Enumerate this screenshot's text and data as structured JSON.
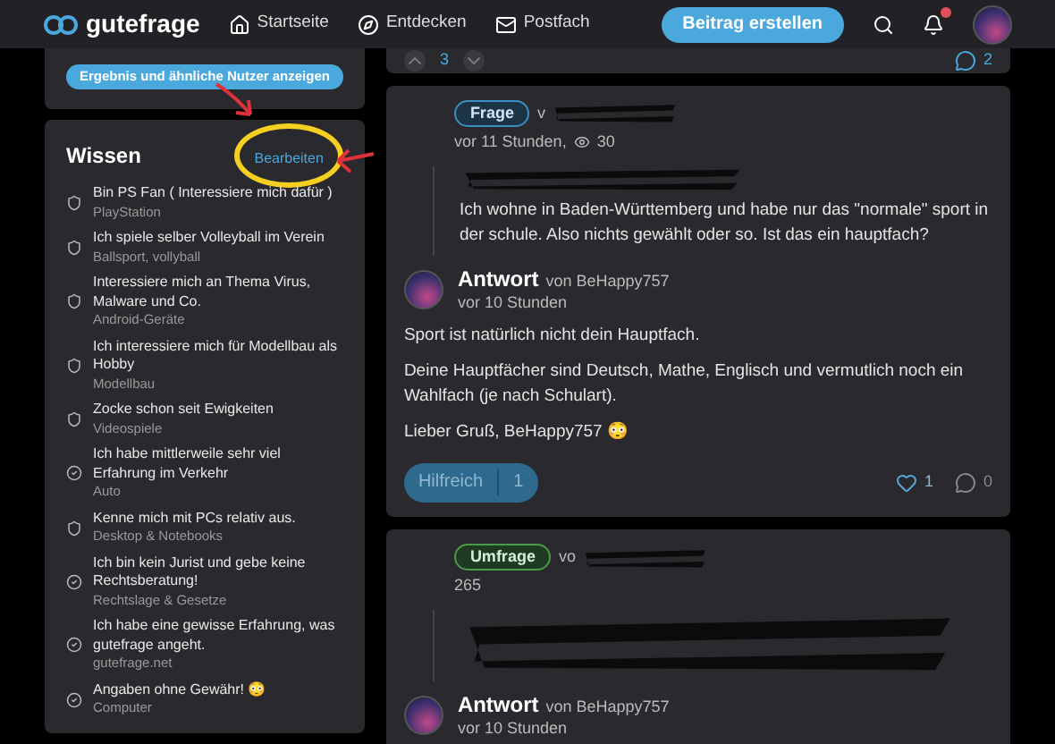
{
  "header": {
    "logo": "gutefrage",
    "nav": [
      {
        "label": "Startseite",
        "kind": "home"
      },
      {
        "label": "Entdecken",
        "kind": "compass"
      },
      {
        "label": "Postfach",
        "kind": "mail"
      }
    ],
    "create_button": "Beitrag erstellen"
  },
  "sidebar": {
    "top_button": "Ergebnis und ähnliche Nutzer anzeigen",
    "knowledge": {
      "title": "Wissen",
      "edit_link": "Bearbeiten",
      "items": [
        {
          "text": "Bin PS Fan ( Interessiere mich dafür )",
          "topic": "PlayStation",
          "kind": "interest"
        },
        {
          "text": "Ich spiele selber Volleyball im Verein",
          "topic": "Ballsport, vollyball",
          "kind": "interest"
        },
        {
          "text": "Interessiere mich an Thema Virus, Malware und Co.",
          "topic": "Android-Geräte",
          "kind": "interest"
        },
        {
          "text": "Ich interessiere mich für Modellbau als Hobby",
          "topic": "Modellbau",
          "kind": "interest"
        },
        {
          "text": "Zocke schon seit Ewigkeiten",
          "topic": "Videospiele",
          "kind": "interest"
        },
        {
          "text": "Ich habe mittlerweile sehr viel Erfahrung im Verkehr",
          "topic": "Auto",
          "kind": "experience"
        },
        {
          "text": "Kenne mich mit PCs relativ aus.",
          "topic": "Desktop & Notebooks",
          "kind": "interest"
        },
        {
          "text": "Ich bin kein Jurist und gebe keine Rechtsberatung!",
          "topic": "Rechtslage & Gesetze",
          "kind": "experience"
        },
        {
          "text": "Ich habe eine gewisse Erfahrung, was gutefrage angeht.",
          "topic": "gutefrage.net",
          "kind": "experience"
        },
        {
          "text": "Angaben ohne Gewähr! 😳",
          "topic": "Computer",
          "kind": "experience"
        }
      ]
    }
  },
  "feed": {
    "top_card": {
      "votes": "3",
      "comments": "2"
    },
    "posts": [
      {
        "badge": "Frage",
        "kind": "question",
        "by": "v",
        "meta": "vor 11 Stunden,",
        "views": "30",
        "body": "Ich wohne in Baden-Württemberg und habe nur das \"normale\" sport in der schule. Also nichts gewählt oder so. Ist das ein hauptfach?",
        "answer": {
          "label": "Antwort",
          "by": "von BeHappy757",
          "time": "vor 10 Stunden",
          "paragraphs": [
            "Sport ist natürlich nicht dein Hauptfach.",
            "Deine Hauptfächer sind Deutsch, Mathe, Englisch und vermutlich noch ein Wahlfach (je nach Schulart).",
            "Lieber Gruß, BeHappy757 😳"
          ],
          "helpful": "Hilfreich",
          "helpful_count": "1",
          "likes": "1",
          "comments": "0"
        }
      },
      {
        "badge": "Umfrage",
        "kind": "poll",
        "by": "vo",
        "meta": "265",
        "answer": {
          "label": "Antwort",
          "by": "von BeHappy757",
          "time": "vor 10 Stunden"
        }
      }
    ]
  }
}
